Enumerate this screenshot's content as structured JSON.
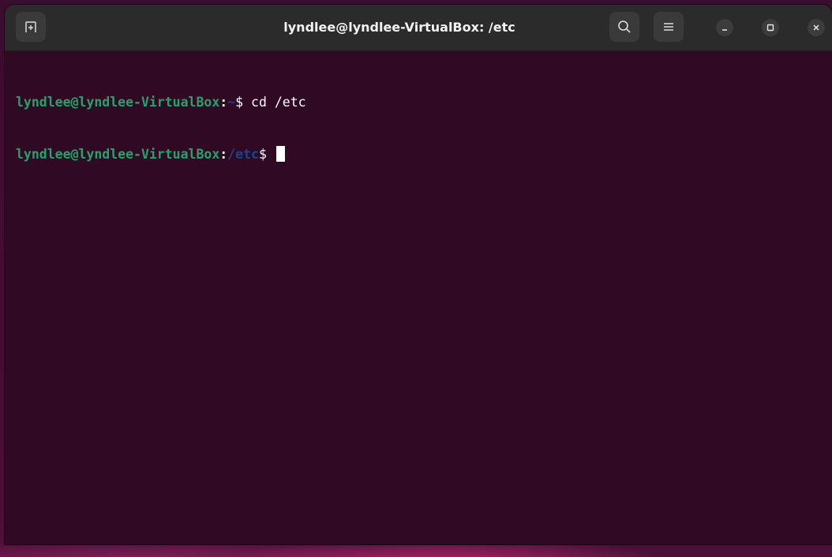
{
  "window": {
    "title": "lyndlee@lyndlee-VirtualBox: /etc"
  },
  "icons": {
    "new_tab": "new-tab-icon",
    "search": "search-icon",
    "menu": "hamburger-menu-icon",
    "minimize": "minimize-icon",
    "maximize": "maximize-icon",
    "close": "close-icon"
  },
  "terminal": {
    "lines": [
      {
        "user_host": "lyndlee@lyndlee-VirtualBox",
        "colon": ":",
        "path": "~",
        "prompt": "$",
        "command": " cd /etc"
      },
      {
        "user_host": "lyndlee@lyndlee-VirtualBox",
        "colon": ":",
        "path": "/etc",
        "prompt": "$",
        "command": " "
      }
    ]
  },
  "colors": {
    "terminal_background": "#300a24",
    "titlebar_background": "#2b2b2b",
    "prompt_user": "#26a269",
    "prompt_path": "#12488b",
    "text": "#ffffff"
  }
}
